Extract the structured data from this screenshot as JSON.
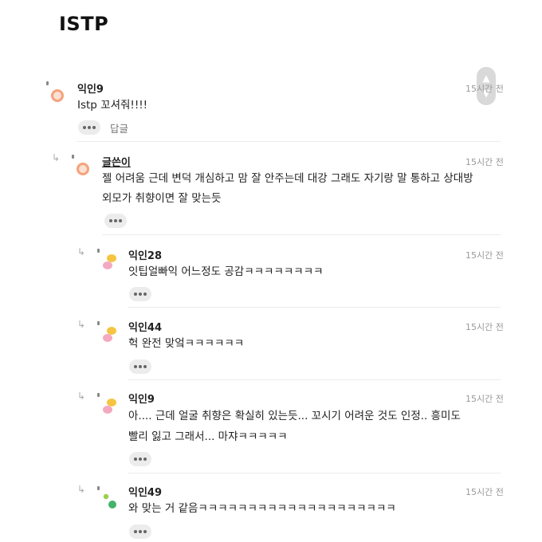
{
  "page": {
    "title": "ISTP"
  },
  "scroll_widget": {
    "up_icon": "▲",
    "down_icon": "▼"
  },
  "comments": [
    {
      "author": "익인9",
      "time": "15시간 전",
      "text": "Istp 꼬셔줘!!!!",
      "reply_label": "답글",
      "avatar": "orange-ring-icon"
    },
    {
      "author": "글쓴이",
      "time": "15시간 전",
      "text_line1": "젤 어려움 근데 변덕 개심하고 맘 잘 안주는데 대강 그래도 자기랑 말 통하고 상대방",
      "text_line2": "외모가 취향이면 잘 맞는듯",
      "avatar": "orange-ring-icon"
    },
    {
      "author": "익인28",
      "time": "15시간 전",
      "text": "잇팁얼빠익 어느정도 공감ㅋㅋㅋㅋㅋㅋㅋㅋ",
      "avatar": "yellow-pink-blob-icon"
    },
    {
      "author": "익인44",
      "time": "15시간 전",
      "text": "헉 완전 맞엌ㅋㅋㅋㅋㅋㅋ",
      "avatar": "yellow-pink-blob-icon"
    },
    {
      "author": "익인9",
      "time": "15시간 전",
      "text_line1": "아.... 근데 얼굴 취향은 확실히 있는듯... 꼬시기 어려운 것도 인정.. 흥미도",
      "text_line2": "빨리 잃고 그래서... 마쟈ㅋㅋㅋㅋㅋ",
      "avatar": "yellow-pink-blob-icon"
    },
    {
      "author": "익인49",
      "time": "15시간 전",
      "text": "와 맞는 거 같음ㅋㅋㅋㅋㅋㅋㅋㅋㅋㅋㅋㅋㅋㅋㅋㅋㅋㅋㅋㅋ",
      "avatar": "green-dots-icon"
    }
  ],
  "colors": {
    "accent_orange": "#f5a27c",
    "avatar_yellow": "#f5c542",
    "avatar_pink": "#f4a9c0",
    "avatar_green": "#45b26b"
  }
}
